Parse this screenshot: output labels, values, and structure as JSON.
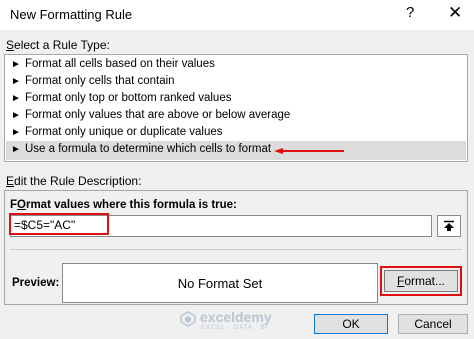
{
  "dialog": {
    "title": "New Formatting Rule",
    "help_icon": "?",
    "close_icon": "✕"
  },
  "rule_type": {
    "label_accel": "S",
    "label_rest": "elect a Rule Type:",
    "items": [
      {
        "label": "Format all cells based on their values"
      },
      {
        "label": "Format only cells that contain"
      },
      {
        "label": "Format only top or bottom ranked values"
      },
      {
        "label": "Format only values that are above or below average"
      },
      {
        "label": "Format only unique or duplicate values"
      },
      {
        "label": "Use a formula to determine which cells to format",
        "selected": true
      }
    ]
  },
  "description": {
    "label_accel": "E",
    "label_rest": "dit the Rule Description:",
    "formula_label_accel": "O",
    "formula_label_pre": "F",
    "formula_label_rest": "rmat values where this formula is true:",
    "formula_value": "=$C5=\"AC\""
  },
  "preview": {
    "label": "Preview:",
    "text": "No Format Set"
  },
  "buttons": {
    "format_accel": "F",
    "format_rest": "ormat...",
    "ok": "OK",
    "cancel": "Cancel"
  },
  "watermark": {
    "name": "exceldemy",
    "tagline": "EXCEL · DATA · BI"
  },
  "colors": {
    "highlight_red": "#e01010",
    "selected_row": "#dcdcdc",
    "ok_border": "#0078d7"
  }
}
